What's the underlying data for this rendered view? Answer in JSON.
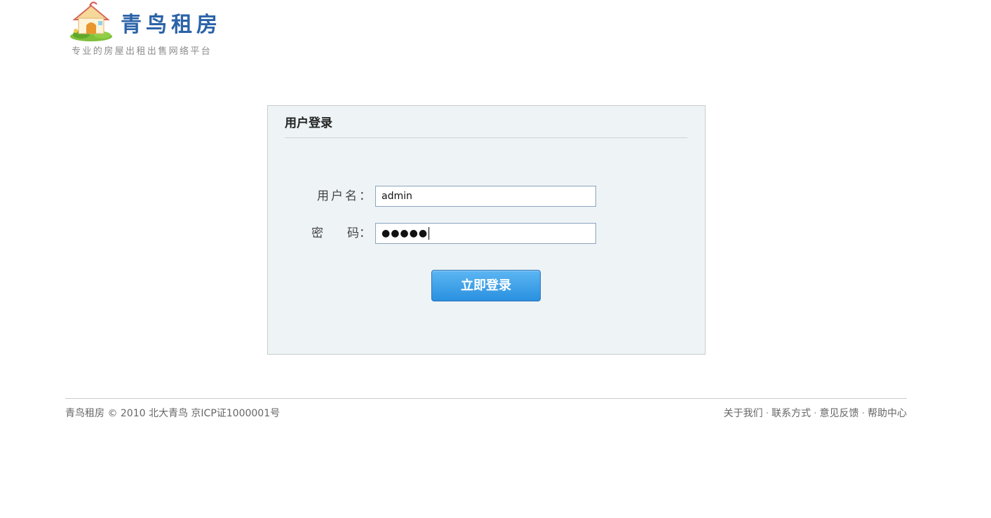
{
  "header": {
    "logo_title": "青鸟租房",
    "slogan": "专业的房屋出租出售网络平台",
    "logo_icon": "house-icon"
  },
  "login": {
    "title": "用户登录",
    "username_label": "用户名：",
    "password_label_1": "密",
    "password_label_2": "码：",
    "username_value": "admin",
    "password_masked": "●●●●●",
    "submit_label": "立即登录"
  },
  "footer": {
    "copyright": "青鸟租房 © 2010 北大青鸟 京ICP证1000001号",
    "links": [
      "关于我们",
      "联系方式",
      "意见反馈",
      "帮助中心"
    ],
    "separator": "·"
  },
  "colors": {
    "brand": "#2b63a8",
    "panel_bg": "#eef3f6",
    "button": "#2a90e0"
  }
}
